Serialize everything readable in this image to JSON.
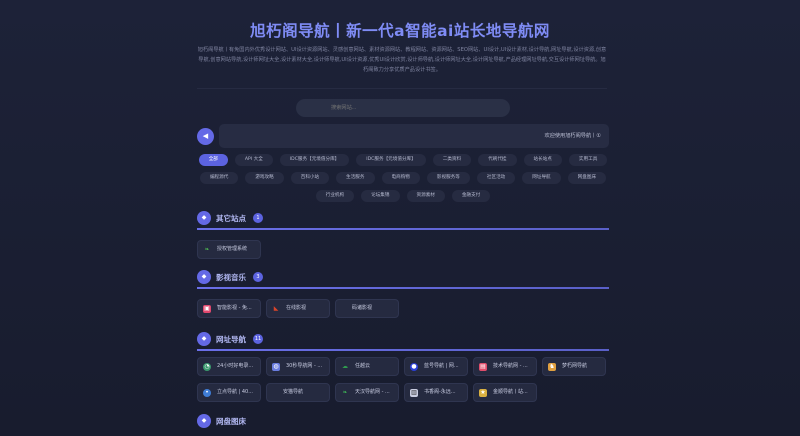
{
  "header": {
    "title": "旭朽阁导航丨新一代a智能ai站长地导航网",
    "description": "旭朽阁导航丨有免国内外优秀设计网站、UI设计资源网站、灵感创意网站、素材资源网站、教程网站、资源网站、SEO网站、UI设计,UI设计素材,设计导航,网址导航,设计资源,创意导航,创意网站导航,设计师网址大全,设计素材大全,设计师导航,UI设计资源,优秀UI设计欣赏,设计师导航,设计师网址大全,设计网址导航,产品经理网址导航,交互设计师网址导航。旭朽阁致力分享优质产品设计书签。",
    "search_placeholder": "搜索网站..."
  },
  "notice": {
    "icon": "megaphone-icon",
    "text": "欢迎使用旭朽阁导航丨①"
  },
  "tags": [
    "全部",
    "API 大全",
    "IDC服务【元境值分库】",
    "IDC服务【元境值分库】",
    "二类资料",
    "代刷代挂",
    "站长站点",
    "实用工具",
    "编程源代",
    "游戏攻略",
    "百科小站",
    "生活服务",
    "电商购物",
    "影视服务等",
    "社区活动",
    "网址导航",
    "网盘图床",
    "行业机构",
    "论坛集锦",
    "资源素材",
    "金融支付"
  ],
  "sections": [
    {
      "title": "其它站点",
      "count": "1",
      "items": [
        {
          "label": "授权管理系统",
          "icon": "leaf-icon",
          "color": "#4caf50"
        }
      ]
    },
    {
      "title": "影视音乐",
      "count": "3",
      "items": [
        {
          "label": "智能影视 - 免...",
          "icon": "film-icon",
          "color": "#e0486e"
        },
        {
          "label": "在线影视",
          "icon": "play-icon",
          "color": "#d9442a"
        },
        {
          "label": "码诸影视",
          "icon": "",
          "color": ""
        }
      ]
    },
    {
      "title": "网址导航",
      "count": "11",
      "items": [
        {
          "label": "24小时好电录...",
          "icon": "clock-icon",
          "color": "#3a9a6e"
        },
        {
          "label": "30秒导航网 - ...",
          "icon": "globe-icon",
          "color": "#6a7de0"
        },
        {
          "label": "任越云",
          "icon": "cloud-icon",
          "color": "#2f9a4e"
        },
        {
          "label": "蓝号导航 | 网...",
          "icon": "circle-icon",
          "color": "#2b3fd6"
        },
        {
          "label": "技术导航网 - ...",
          "icon": "book-icon",
          "color": "#e04d6b"
        },
        {
          "label": "梦朽网导航",
          "icon": "cat-icon",
          "color": "#e0a040"
        },
        {
          "label": "立点导航 | 40...",
          "icon": "dot-icon",
          "color": "#3f7dd6"
        },
        {
          "label": "安猫导航",
          "icon": "",
          "color": ""
        },
        {
          "label": "天汉导航网 - ...",
          "icon": "leaf-icon",
          "color": "#3cad55"
        },
        {
          "label": "书香阁-永远...",
          "icon": "book-open-icon",
          "color": "#c9cde0"
        },
        {
          "label": "金顺导航丨站...",
          "icon": "star-icon",
          "color": "#d9b040"
        }
      ]
    },
    {
      "title": "网盘图床",
      "count": "",
      "items": []
    }
  ]
}
